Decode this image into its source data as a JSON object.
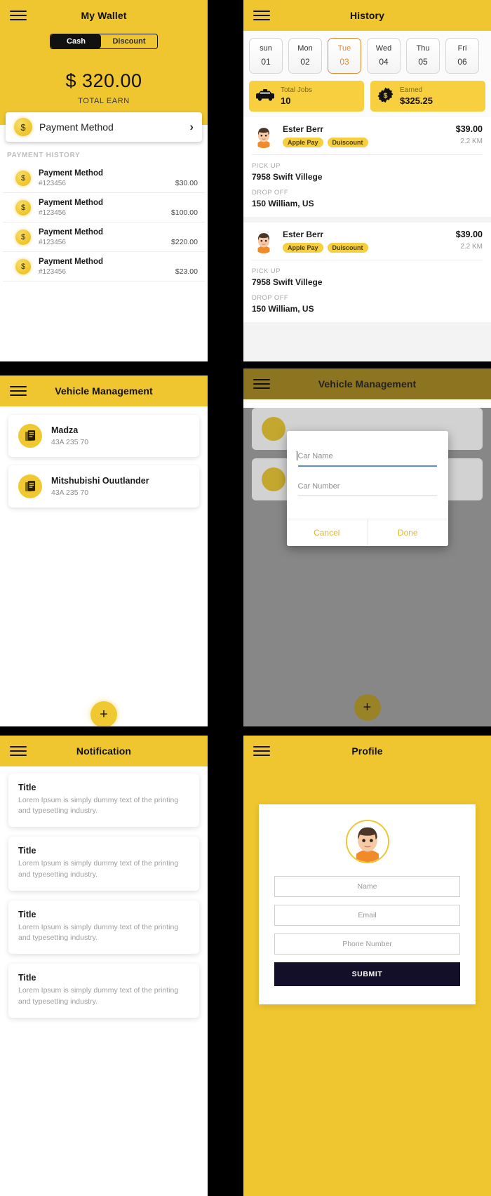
{
  "theme": {
    "yellow": "#efc62f",
    "yellow_deep": "#f0c831",
    "dark": "#140f28",
    "orange_accent": "#e08a33",
    "muted": "#a0a0a0"
  },
  "wallet": {
    "title": "My Wallet",
    "menu_icon": "hamburger-icon",
    "segments": [
      {
        "label": "Cash",
        "selected": true
      },
      {
        "label": "Discount",
        "selected": false
      }
    ],
    "amount": "$ 320.00",
    "amount_caption": "TOTAL EARN",
    "payment_method": {
      "label": "Payment Method",
      "icon": "coin-dollar-icon",
      "chevron": "›"
    },
    "history_heading": "PAYMENT HISTORY",
    "history": [
      {
        "name": "Payment Method",
        "id": "#123456",
        "amount": "$30.00"
      },
      {
        "name": "Payment Method",
        "id": "#123456",
        "amount": "$100.00"
      },
      {
        "name": "Payment Method",
        "id": "#123456",
        "amount": "$220.00"
      },
      {
        "name": "Payment Method",
        "id": "#123456",
        "amount": "$23.00"
      }
    ]
  },
  "history": {
    "title": "History",
    "dates": [
      {
        "weekday": "sun",
        "day": "01",
        "active": false
      },
      {
        "weekday": "Mon",
        "day": "02",
        "active": false
      },
      {
        "weekday": "Tue",
        "day": "03",
        "active": true
      },
      {
        "weekday": "Wed",
        "day": "04",
        "active": false
      },
      {
        "weekday": "Thu",
        "day": "05",
        "active": false
      },
      {
        "weekday": "Fri",
        "day": "06",
        "active": false
      }
    ],
    "stats": [
      {
        "icon": "taxi-icon",
        "label": "Total Jobs",
        "value": "10"
      },
      {
        "icon": "dollar-badge-icon",
        "label": "Earned",
        "value": "$325.25"
      }
    ],
    "jobs": [
      {
        "name": "Ester Berr",
        "tags": [
          "Apple Pay",
          "Duiscount"
        ],
        "price": "$39.00",
        "distance": "2.2 KM",
        "pickup_label": "PICK UP",
        "pickup": "7958 Swift Villege",
        "dropoff_label": "DROP OFF",
        "dropoff": "150 William, US"
      },
      {
        "name": "Ester Berr",
        "tags": [
          "Apple Pay",
          "Duiscount"
        ],
        "price": "$39.00",
        "distance": "2.2 KM",
        "pickup_label": "PICK UP",
        "pickup": "7958 Swift Villege",
        "dropoff_label": "DROP OFF",
        "dropoff": "150 William, US"
      }
    ]
  },
  "vehicle": {
    "title": "Vehicle Management",
    "items": [
      {
        "name": "Madza",
        "plate": "43A 235 70",
        "icon": "vehicle-doc-icon"
      },
      {
        "name": "Mitshubishi Ouutlander",
        "plate": "43A 235 70",
        "icon": "vehicle-doc-icon"
      }
    ],
    "add_button": "+"
  },
  "vehicle_dialog": {
    "title": "Vehicle Management",
    "fields": [
      {
        "placeholder": "Car Name",
        "value": "",
        "focused": true
      },
      {
        "placeholder": "Car Number",
        "value": "",
        "focused": false
      }
    ],
    "cancel_label": "Cancel",
    "done_label": "Done",
    "add_button": "+"
  },
  "notification": {
    "title": "Notification",
    "items": [
      {
        "title": "Title",
        "body": "Lorem Ipsum is simply dummy text of the printing and typesetting industry."
      },
      {
        "title": "Title",
        "body": "Lorem Ipsum is simply dummy text of the printing and typesetting industry."
      },
      {
        "title": "Title",
        "body": "Lorem Ipsum is simply dummy text of the printing and typesetting industry."
      },
      {
        "title": "Title",
        "body": "Lorem Ipsum is simply dummy text of the printing and typesetting industry."
      }
    ]
  },
  "profile": {
    "title": "Profile",
    "avatar": "user-avatar-icon",
    "fields": [
      {
        "placeholder": "Name",
        "value": ""
      },
      {
        "placeholder": "Email",
        "value": ""
      },
      {
        "placeholder": "Phone Number",
        "value": ""
      }
    ],
    "submit_label": "SUBMIT"
  }
}
